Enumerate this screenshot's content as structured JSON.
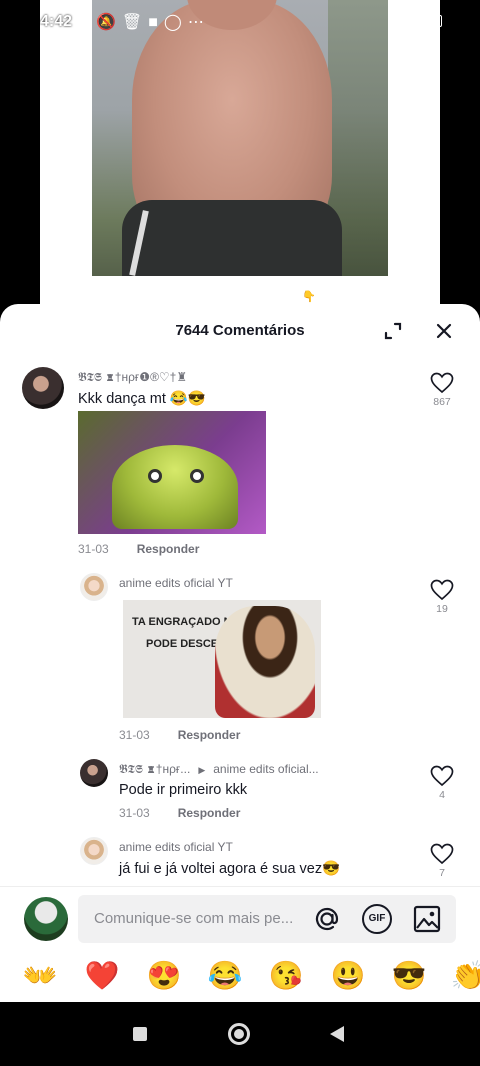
{
  "status_bar": {
    "time": "4:42",
    "battery": "7"
  },
  "video": {
    "caption_glyph": "👇"
  },
  "comments_panel": {
    "title": "7644 Comentários",
    "comments": [
      {
        "username": "𝕭𝕿𝕾 ♜†нρғ❶®♡†♜",
        "text": "Kkk dança mt 😂😎",
        "date": "31-03",
        "reply_label": "Responder",
        "likes": "867"
      },
      {
        "username": "anime edits oficial YT",
        "sticker_text": [
          "TA ENGRAÇADO NÉ...",
          "PODE DESCER"
        ],
        "date": "31-03",
        "reply_label": "Responder",
        "likes": "19"
      },
      {
        "username": "𝕭𝕿𝕾 ♜†нρғ...",
        "reply_to": "anime edits oficial...",
        "text": "Pode ir primeiro kkk",
        "date": "31-03",
        "reply_label": "Responder",
        "likes": "4"
      },
      {
        "username": "anime edits oficial YT",
        "text": "já fui e já voltei agora é sua vez😎",
        "likes": "7"
      }
    ]
  },
  "input": {
    "placeholder": "Comunique-se com mais pe...",
    "mention_icon": "at-icon",
    "gif_label": "GIF",
    "image_icon": "image-icon"
  },
  "emoji_bar": [
    "👐",
    "❤️",
    "😍",
    "😂",
    "😘",
    "😃",
    "😎",
    "👏"
  ],
  "colors": {
    "text": "#161823",
    "muted": "#8a8b91",
    "heart": "#161823"
  }
}
